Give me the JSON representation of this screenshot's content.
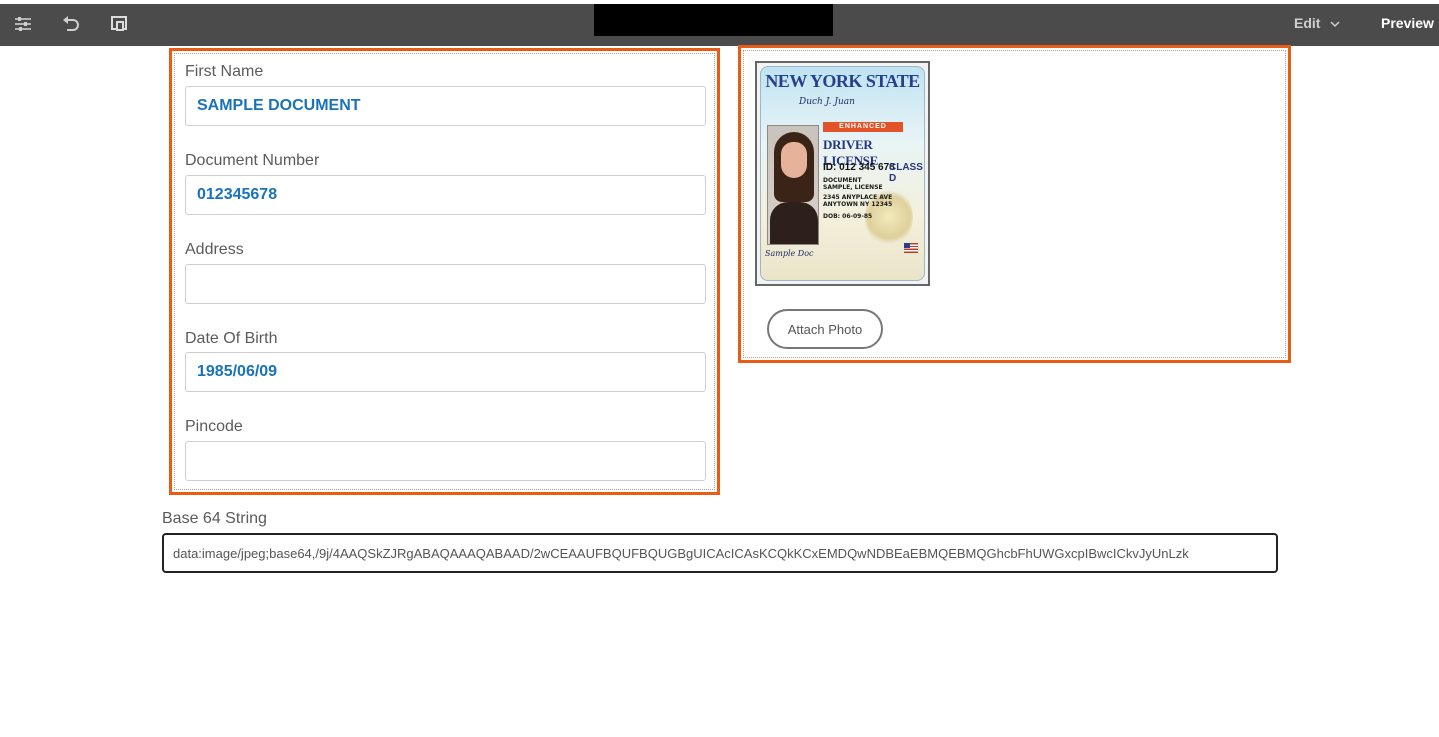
{
  "toolbar": {
    "icons": [
      "properties-icon",
      "undo-icon",
      "layout-icon"
    ],
    "edit_label": "Edit",
    "preview_label": "Preview"
  },
  "form": {
    "first_name": {
      "label": "First Name",
      "value": "SAMPLE DOCUMENT"
    },
    "document_number": {
      "label": "Document Number",
      "value": "012345678"
    },
    "address": {
      "label": "Address",
      "value": ""
    },
    "date_of_birth": {
      "label": "Date Of Birth",
      "value": "1985/06/09"
    },
    "pincode": {
      "label": "Pincode",
      "value": ""
    }
  },
  "license": {
    "state": "NEW YORK STATE",
    "enhanced": "ENHANCED",
    "title": "DRIVER LICENSE",
    "id": "ID: 012 345 678",
    "class": "CLASS D",
    "lines": [
      "DOCUMENT",
      "SAMPLE, LICENSE",
      "2345 ANYPLACE AVE",
      "ANYTOWN NY 12345"
    ],
    "dob": "DOB: 06-09-85"
  },
  "attach_label": "Attach Photo",
  "base64": {
    "label": "Base 64 String",
    "value": "data:image/jpeg;base64,/9j/4AAQSkZJRgABAQAAAQABAAD/2wCEAAUFBQUFBQUGBgUICAcICAsKCQkKCxEMDQwNDBEaEBMQEBMQGhcbFhUWGxcpIBwcICkvJyUnLzk"
  },
  "colors": {
    "accent": "#ea5b15",
    "value_text": "#1a73b8",
    "toolbar": "#4b4b4b"
  }
}
